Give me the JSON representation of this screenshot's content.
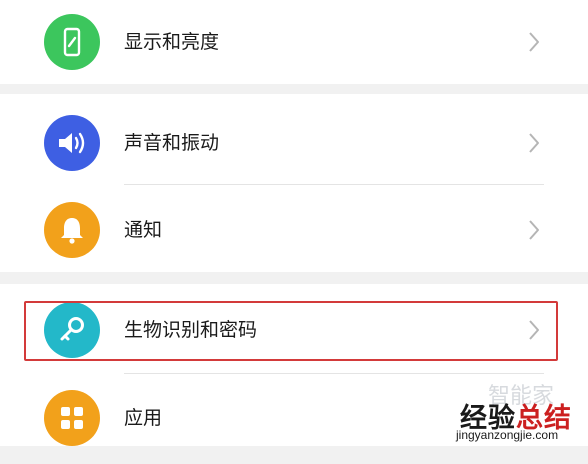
{
  "settings": {
    "items": [
      {
        "label": "显示和亮度",
        "icon": "phone-brightness-icon",
        "color": "#3cc65d"
      },
      {
        "label": "声音和振动",
        "icon": "speaker-icon",
        "color": "#3e5fe3"
      },
      {
        "label": "通知",
        "icon": "bell-icon",
        "color": "#f2a11b"
      },
      {
        "label": "生物识别和密码",
        "icon": "key-icon",
        "color": "#23b8c9"
      },
      {
        "label": "应用",
        "icon": "apps-grid-icon",
        "color": "#f2a11b"
      }
    ]
  },
  "highlight": {
    "color": "#d33a3a",
    "target": "生物识别和密码"
  },
  "watermark": {
    "faint": "智能家",
    "cn_part1": "经验",
    "cn_part2": "总结",
    "url": "jingyanzongjie.com"
  }
}
